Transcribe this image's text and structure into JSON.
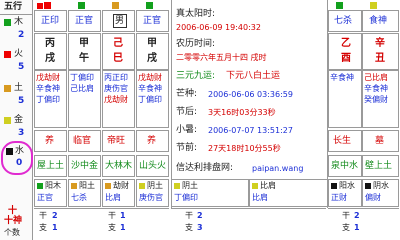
{
  "wuxing": {
    "header": "五行",
    "elements": [
      {
        "name": "木",
        "count": "2"
      },
      {
        "name": "火",
        "count": "5"
      },
      {
        "name": "土",
        "count": "5"
      },
      {
        "name": "金",
        "count": "3"
      },
      {
        "name": "水",
        "count": "0"
      }
    ]
  },
  "pillars": [
    {
      "shishen": "正印",
      "gan": "丙",
      "zhi": "戌",
      "canggan": [
        "戊劫财",
        "辛食神",
        "丁偏印"
      ],
      "changsheng": "养",
      "nayin": "屋上土"
    },
    {
      "shishen": "正官",
      "gan": "甲",
      "zhi": "午",
      "canggan": [
        "丁偏印",
        "己比肩"
      ],
      "changsheng": "临官",
      "nayin": "沙中金"
    },
    {
      "shishen": "男",
      "gan": "己",
      "zhi": "巳",
      "canggan": [
        "丙正印",
        "庚伤官",
        "戊劫财"
      ],
      "changsheng": "帝旺",
      "nayin": "大林木"
    },
    {
      "shishen": "正官",
      "gan": "甲",
      "zhi": "戌",
      "canggan": [
        "戊劫财",
        "辛食神",
        "丁偏印"
      ],
      "changsheng": "养",
      "nayin": "山头火"
    }
  ],
  "info": {
    "zhenshi_label": "真太阳时:",
    "zhenshi_value": "2006-06-09 19:40:32",
    "nongli_label": "农历时间:",
    "nongli_value": "二零零六年五月十四 戌时",
    "sanyuan_label": "三元九运:",
    "sanyuan_value": "下元八白土运",
    "mangzhong_label": "芒种:",
    "mangzhong_value": "2006-06-06 03:36:59",
    "jieqi_label": "节后:",
    "jieqi_value": "3天16时03分33秒",
    "xiaoshu_label": "小暑:",
    "xiaoshu_value": "2006-07-07 13:51:27",
    "jieqian_label": "节前:",
    "jieqian_value": "27天18时10分55秒",
    "paipan_label": "信达利排盘网:",
    "paipan_value": "paipan.wang"
  },
  "right": {
    "top_shishen": [
      "七杀",
      "食神"
    ],
    "top_gan": [
      "乙",
      "辛"
    ],
    "top_zhi": [
      "酉",
      "丑"
    ],
    "canggan": [
      "辛食神",
      "己比肩",
      "辛食神",
      "癸偏财"
    ],
    "changsheng": [
      "长生",
      "墓"
    ],
    "nayin": [
      "泉中水",
      "壁上土"
    ]
  },
  "bottom": {
    "yinyang_left": [
      "阳木",
      "正官",
      "七杀"
    ],
    "yinyang_mid1": [
      "阳土",
      "劫财",
      "比肩"
    ],
    "yinyang_mid2": [
      "阴土",
      "比肩",
      "庚伤官"
    ],
    "yinyang_mid3": [
      "阴土",
      "比肩",
      "丁偏印"
    ],
    "yinyang_right1": [
      "阳水",
      "正财",
      "正印"
    ],
    "yinyang_right2": [
      "阴水",
      "偏财",
      "偏印"
    ],
    "row_label_a": "十",
    "row_label_b": "十神",
    "row_label_c": "个数",
    "gan_label": "干",
    "zhi_label": "支",
    "counts_top": [
      "2",
      "1",
      "2",
      "2"
    ],
    "counts_bot": [
      "1",
      "1",
      "3",
      "1"
    ]
  }
}
